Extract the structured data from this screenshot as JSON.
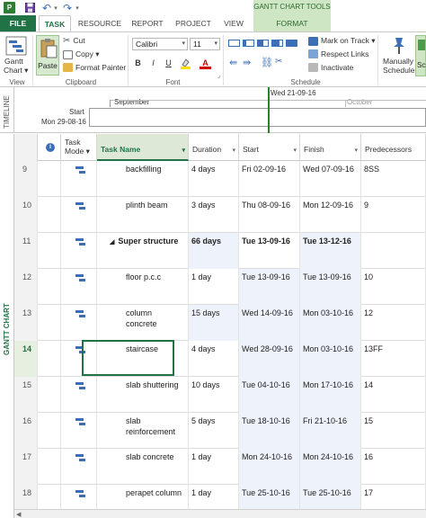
{
  "title_bar": {
    "app_icon": "P",
    "contextual_group": "GANTT CHART TOOLS"
  },
  "tabs": [
    {
      "label": "FILE"
    },
    {
      "label": "TASK"
    },
    {
      "label": "RESOURCE"
    },
    {
      "label": "REPORT"
    },
    {
      "label": "PROJECT"
    },
    {
      "label": "VIEW"
    },
    {
      "label": "FORMAT"
    }
  ],
  "ribbon": {
    "view": {
      "gantt_line1": "Gantt",
      "gantt_line2": "Chart ▾",
      "group_label": "View"
    },
    "clipboard": {
      "paste": "Paste",
      "cut": "Cut",
      "copy": "Copy ▾",
      "format_painter": "Format Painter",
      "group_label": "Clipboard"
    },
    "font": {
      "family": "Calibri",
      "size": "11",
      "bold": "B",
      "italic": "I",
      "underline": "U",
      "group_label": "Font"
    },
    "schedule": {
      "mark_on_track": "Mark on Track ▾",
      "respect_links": "Respect Links",
      "inactivate": "Inactivate",
      "group_label": "Schedule"
    },
    "tasks": {
      "manually_line1": "Manually",
      "manually_line2": "Schedule",
      "auto_partial": "Sc"
    }
  },
  "timeline": {
    "side_label": "TIMELINE",
    "today_label": "Wed 21-09-16",
    "month_september": "September",
    "month_october": "October",
    "start_label": "Start",
    "start_date": "Mon 29-08-16"
  },
  "gantt_side_label": "GANTT CHART",
  "columns": {
    "info": "i",
    "task_mode_line1": "Task",
    "task_mode_line2": "Mode ▾",
    "task_name": "Task Name",
    "duration": "Duration",
    "start": "Start",
    "finish": "Finish",
    "predecessors": "Predecessors"
  },
  "rows": [
    {
      "id": "9",
      "name": "backfilling",
      "duration": "4 days",
      "start": "Fri 02-09-16",
      "finish": "Wed 07-09-16",
      "pred": "8SS"
    },
    {
      "id": "10",
      "name": "plinth beam",
      "duration": "3 days",
      "start": "Thu 08-09-16",
      "finish": "Mon 12-09-16",
      "pred": "9"
    },
    {
      "id": "11",
      "name": "Super structure",
      "duration": "66 days",
      "start": "Tue 13-09-16",
      "finish": "Tue 13-12-16",
      "pred": "",
      "collapse": "◢"
    },
    {
      "id": "12",
      "name": "floor p.c.c",
      "duration": "1 day",
      "start": "Tue 13-09-16",
      "finish": "Tue 13-09-16",
      "pred": "10"
    },
    {
      "id": "13",
      "name": "column concrete",
      "duration": "15 days",
      "start": "Wed 14-09-16",
      "finish": "Mon 03-10-16",
      "pred": "12"
    },
    {
      "id": "14",
      "name": "staircase",
      "duration": "4 days",
      "start": "Wed 28-09-16",
      "finish": "Mon 03-10-16",
      "pred": "13FF"
    },
    {
      "id": "15",
      "name": "slab shuttering",
      "duration": "10 days",
      "start": "Tue 04-10-16",
      "finish": "Mon 17-10-16",
      "pred": "14"
    },
    {
      "id": "16",
      "name": "slab reinforcement",
      "duration": "5 days",
      "start": "Tue 18-10-16",
      "finish": "Fri 21-10-16",
      "pred": "15"
    },
    {
      "id": "17",
      "name": "slab concrete",
      "duration": "1 day",
      "start": "Mon 24-10-16",
      "finish": "Mon 24-10-16",
      "pred": "16"
    },
    {
      "id": "18",
      "name": "perapet column",
      "duration": "1 day",
      "start": "Tue 25-10-16",
      "finish": "Tue 25-10-16",
      "pred": "17"
    }
  ],
  "colors": {
    "accent": "#217346",
    "highlight": "#eef2fb",
    "mode_icon": "#3c6fb5"
  }
}
